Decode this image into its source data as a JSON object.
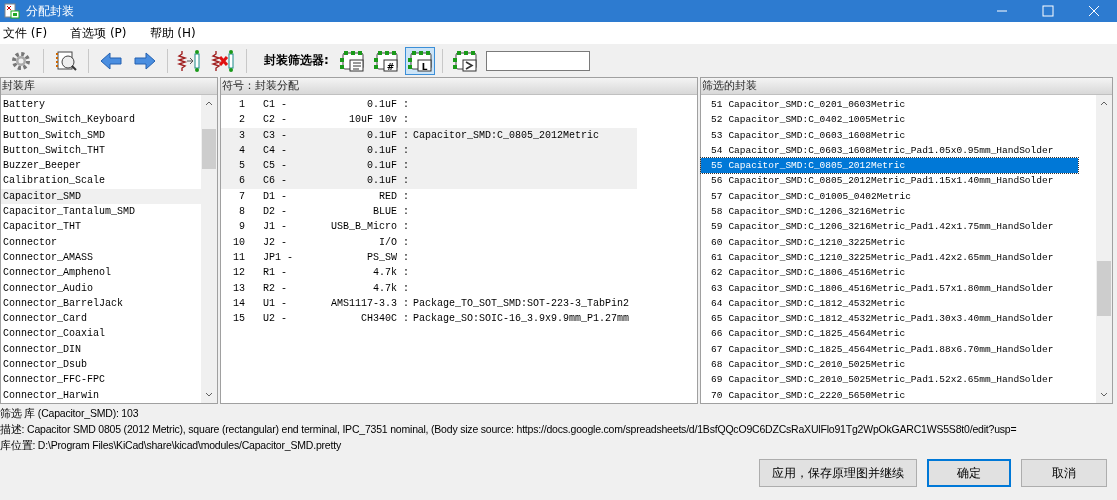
{
  "window": {
    "title": "分配封装"
  },
  "menu": [
    "文件 (F)",
    "首选项 (P)",
    "帮助 (H)"
  ],
  "toolbar": {
    "filter_label": "封装筛选器:",
    "filters": [
      {
        "kind": "keywords",
        "on": false
      },
      {
        "kind": "pincount",
        "glyph": "#",
        "on": false
      },
      {
        "kind": "library",
        "glyph": "L",
        "on": true
      },
      {
        "kind": "text",
        "on": false
      }
    ]
  },
  "libraries": {
    "header": "封装库",
    "items": [
      {
        "name": "Battery",
        "selected": false
      },
      {
        "name": "Button_Switch_Keyboard",
        "selected": false
      },
      {
        "name": "Button_Switch_SMD",
        "selected": false
      },
      {
        "name": "Button_Switch_THT",
        "selected": false
      },
      {
        "name": "Buzzer_Beeper",
        "selected": false
      },
      {
        "name": "Calibration_Scale",
        "selected": false
      },
      {
        "name": "Capacitor_SMD",
        "selected": true
      },
      {
        "name": "Capacitor_Tantalum_SMD",
        "selected": false
      },
      {
        "name": "Capacitor_THT",
        "selected": false
      },
      {
        "name": "Connector",
        "selected": false
      },
      {
        "name": "Connector_AMASS",
        "selected": false
      },
      {
        "name": "Connector_Amphenol",
        "selected": false
      },
      {
        "name": "Connector_Audio",
        "selected": false
      },
      {
        "name": "Connector_BarrelJack",
        "selected": false
      },
      {
        "name": "Connector_Card",
        "selected": false
      },
      {
        "name": "Connector_Coaxial",
        "selected": false
      },
      {
        "name": "Connector_DIN",
        "selected": false
      },
      {
        "name": "Connector_Dsub",
        "selected": false
      },
      {
        "name": "Connector_FFC-FPC",
        "selected": false
      },
      {
        "name": "Connector_Harwin",
        "selected": false
      }
    ]
  },
  "assignments": {
    "header": "符号：封装分配",
    "rows": [
      {
        "num": "1",
        "ref": "C1 -",
        "value": "0.1uF :",
        "selected": false
      },
      {
        "num": "2",
        "ref": "C2 -",
        "value": "10uF 10v :",
        "selected": false
      },
      {
        "num": "3",
        "ref": "C3 -",
        "value": "0.1uF :",
        "footprint": "Capacitor_SMD:C_0805_2012Metric",
        "selected": true
      },
      {
        "num": "4",
        "ref": "C4 -",
        "value": "0.1uF :",
        "selected": true
      },
      {
        "num": "5",
        "ref": "C5 -",
        "value": "0.1uF :",
        "selected": true
      },
      {
        "num": "6",
        "ref": "C6 -",
        "value": "0.1uF :",
        "selected": true
      },
      {
        "num": "7",
        "ref": "D1 -",
        "value": "RED :",
        "selected": false
      },
      {
        "num": "8",
        "ref": "D2 -",
        "value": "BLUE :",
        "selected": false
      },
      {
        "num": "9",
        "ref": "J1 -",
        "value": "USB_B_Micro :",
        "selected": false
      },
      {
        "num": "10",
        "ref": "J2 -",
        "value": "I/O :",
        "selected": false
      },
      {
        "num": "11",
        "ref": "JP1 -",
        "value": "PS_SW :",
        "selected": false
      },
      {
        "num": "12",
        "ref": "R1 -",
        "value": "4.7k :",
        "selected": false
      },
      {
        "num": "13",
        "ref": "R2 -",
        "value": "4.7k :",
        "selected": false
      },
      {
        "num": "14",
        "ref": "U1 -",
        "value": "AMS1117-3.3 :",
        "footprint": "Package_TO_SOT_SMD:SOT-223-3_TabPin2",
        "selected": false
      },
      {
        "num": "15",
        "ref": "U2 -",
        "value": "CH340C :",
        "footprint": "Package_SO:SOIC-16_3.9x9.9mm_P1.27mm",
        "selected": false
      }
    ]
  },
  "footprints": {
    "header": "筛选的封装",
    "items": [
      {
        "num": "51",
        "name": "Capacitor_SMD:C_0201_0603Metric",
        "selected": false
      },
      {
        "num": "52",
        "name": "Capacitor_SMD:C_0402_1005Metric",
        "selected": false
      },
      {
        "num": "53",
        "name": "Capacitor_SMD:C_0603_1608Metric",
        "selected": false
      },
      {
        "num": "54",
        "name": "Capacitor_SMD:C_0603_1608Metric_Pad1.05x0.95mm_HandSolder",
        "selected": false
      },
      {
        "num": "55",
        "name": "Capacitor_SMD:C_0805_2012Metric",
        "selected": true
      },
      {
        "num": "56",
        "name": "Capacitor_SMD:C_0805_2012Metric_Pad1.15x1.40mm_HandSolder",
        "selected": false
      },
      {
        "num": "57",
        "name": "Capacitor_SMD:C_01005_0402Metric",
        "selected": false
      },
      {
        "num": "58",
        "name": "Capacitor_SMD:C_1206_3216Metric",
        "selected": false
      },
      {
        "num": "59",
        "name": "Capacitor_SMD:C_1206_3216Metric_Pad1.42x1.75mm_HandSolder",
        "selected": false
      },
      {
        "num": "60",
        "name": "Capacitor_SMD:C_1210_3225Metric",
        "selected": false
      },
      {
        "num": "61",
        "name": "Capacitor_SMD:C_1210_3225Metric_Pad1.42x2.65mm_HandSolder",
        "selected": false
      },
      {
        "num": "62",
        "name": "Capacitor_SMD:C_1806_4516Metric",
        "selected": false
      },
      {
        "num": "63",
        "name": "Capacitor_SMD:C_1806_4516Metric_Pad1.57x1.80mm_HandSolder",
        "selected": false
      },
      {
        "num": "64",
        "name": "Capacitor_SMD:C_1812_4532Metric",
        "selected": false
      },
      {
        "num": "65",
        "name": "Capacitor_SMD:C_1812_4532Metric_Pad1.30x3.40mm_HandSolder",
        "selected": false
      },
      {
        "num": "66",
        "name": "Capacitor_SMD:C_1825_4564Metric",
        "selected": false
      },
      {
        "num": "67",
        "name": "Capacitor_SMD:C_1825_4564Metric_Pad1.88x6.70mm_HandSolder",
        "selected": false
      },
      {
        "num": "68",
        "name": "Capacitor_SMD:C_2010_5025Metric",
        "selected": false
      },
      {
        "num": "69",
        "name": "Capacitor_SMD:C_2010_5025Metric_Pad1.52x2.65mm_HandSolder",
        "selected": false
      },
      {
        "num": "70",
        "name": "Capacitor_SMD:C_2220_5650Metric",
        "selected": false
      }
    ]
  },
  "status": [
    "筛选 库 (Capacitor_SMD): 103",
    "描述:  Capacitor SMD 0805 (2012 Metric), square (rectangular) end terminal, IPC_7351 nominal, (Body size source: https://docs.google.com/spreadsheets/d/1BsfQQcO9C6DZCsRaXUlFlo91Tg2WpOkGARC1WS5S8t0/edit?usp=",
    "库位置:  D:\\Program Files\\KiCad\\share\\kicad\\modules/Capacitor_SMD.pretty"
  ],
  "buttons": [
    {
      "label": "应用，保存原理图并继续",
      "kind": "normal"
    },
    {
      "label": "确定",
      "kind": "default"
    },
    {
      "label": "取消",
      "kind": "normal"
    }
  ]
}
